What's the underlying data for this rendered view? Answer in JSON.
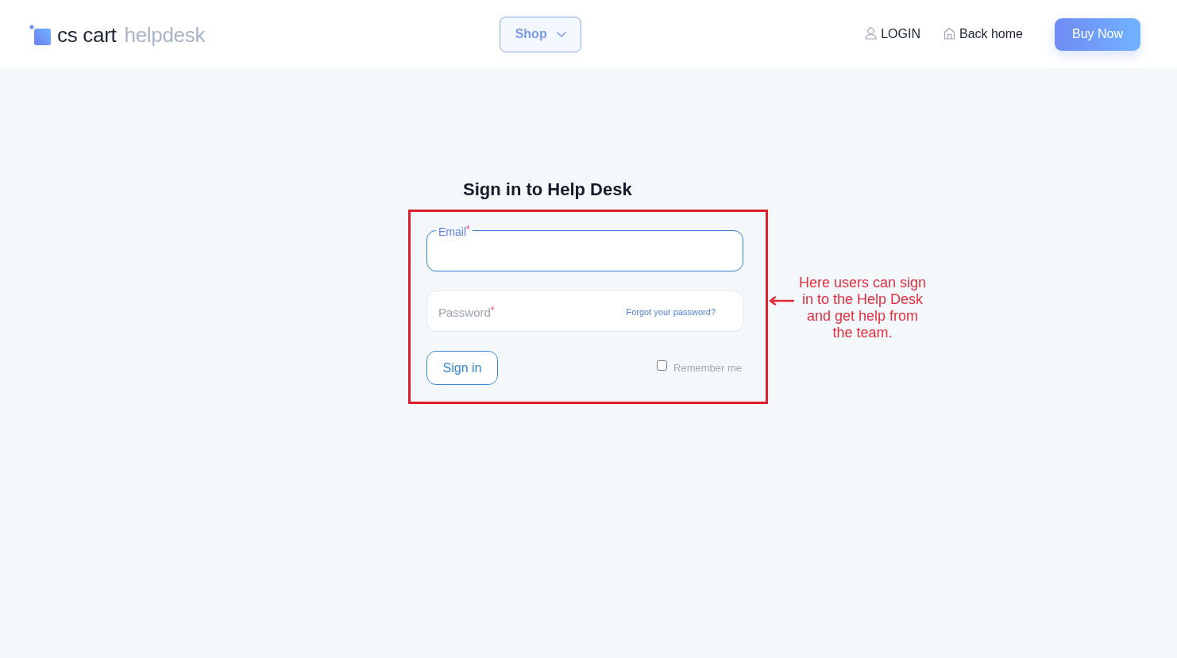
{
  "header": {
    "logo": {
      "brand": "cs cart",
      "product": "helpdesk"
    },
    "menu_button": {
      "label": "Shop",
      "expanded": false
    },
    "nav_links": [
      {
        "kind": "user",
        "label": "LOGIN"
      },
      {
        "kind": "home",
        "label": "Back home"
      }
    ],
    "cta_button": {
      "label": "Buy Now"
    }
  },
  "login_form": {
    "title": "Sign in to Help Desk",
    "fields": [
      {
        "label": "Email",
        "required_mark": "*",
        "focused": true
      },
      {
        "label": "Password",
        "required_mark": "*",
        "focused": false,
        "link": "Forgot your password?"
      }
    ],
    "submit_button": {
      "label": "Sign in"
    },
    "remember": {
      "label": "Remember me",
      "checked": false
    }
  },
  "annotation": {
    "text": "Here users can sign in to the Help Desk and get help from the team."
  }
}
